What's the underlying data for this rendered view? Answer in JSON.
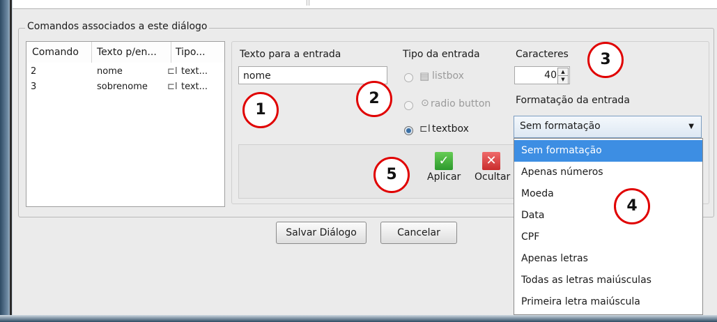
{
  "group": {
    "title": "Comandos associados a este diálogo"
  },
  "table": {
    "headers": [
      "Comando",
      "Texto p/en...",
      "Tipo..."
    ],
    "rows": [
      {
        "cmd": "2",
        "text": "nome",
        "type": "text..."
      },
      {
        "cmd": "3",
        "text": "sobrenome",
        "type": "text..."
      }
    ]
  },
  "entry": {
    "label": "Texto para a entrada",
    "value": "nome"
  },
  "input_type": {
    "label": "Tipo da entrada",
    "options": [
      "listbox",
      "radio button",
      "textbox"
    ],
    "selected": "textbox"
  },
  "chars": {
    "label": "Caracteres",
    "value": "40"
  },
  "format": {
    "label": "Formatação da entrada",
    "selected": "Sem formatação",
    "options": [
      "Sem formatação",
      "Apenas números",
      "Moeda",
      "Data",
      "CPF",
      "Apenas letras",
      "Todas as letras maiúsculas",
      "Primeira letra maiúscula"
    ]
  },
  "actions": {
    "apply": "Aplicar",
    "hide": "Ocultar"
  },
  "footer": {
    "save": "Salvar Diálogo",
    "cancel": "Cancelar"
  },
  "callouts": [
    "1",
    "2",
    "3",
    "4",
    "5"
  ],
  "colors": {
    "accent": "#3d8ee3",
    "callout": "#e00000",
    "apply": "#3aa63a",
    "hide": "#d83a3a"
  }
}
